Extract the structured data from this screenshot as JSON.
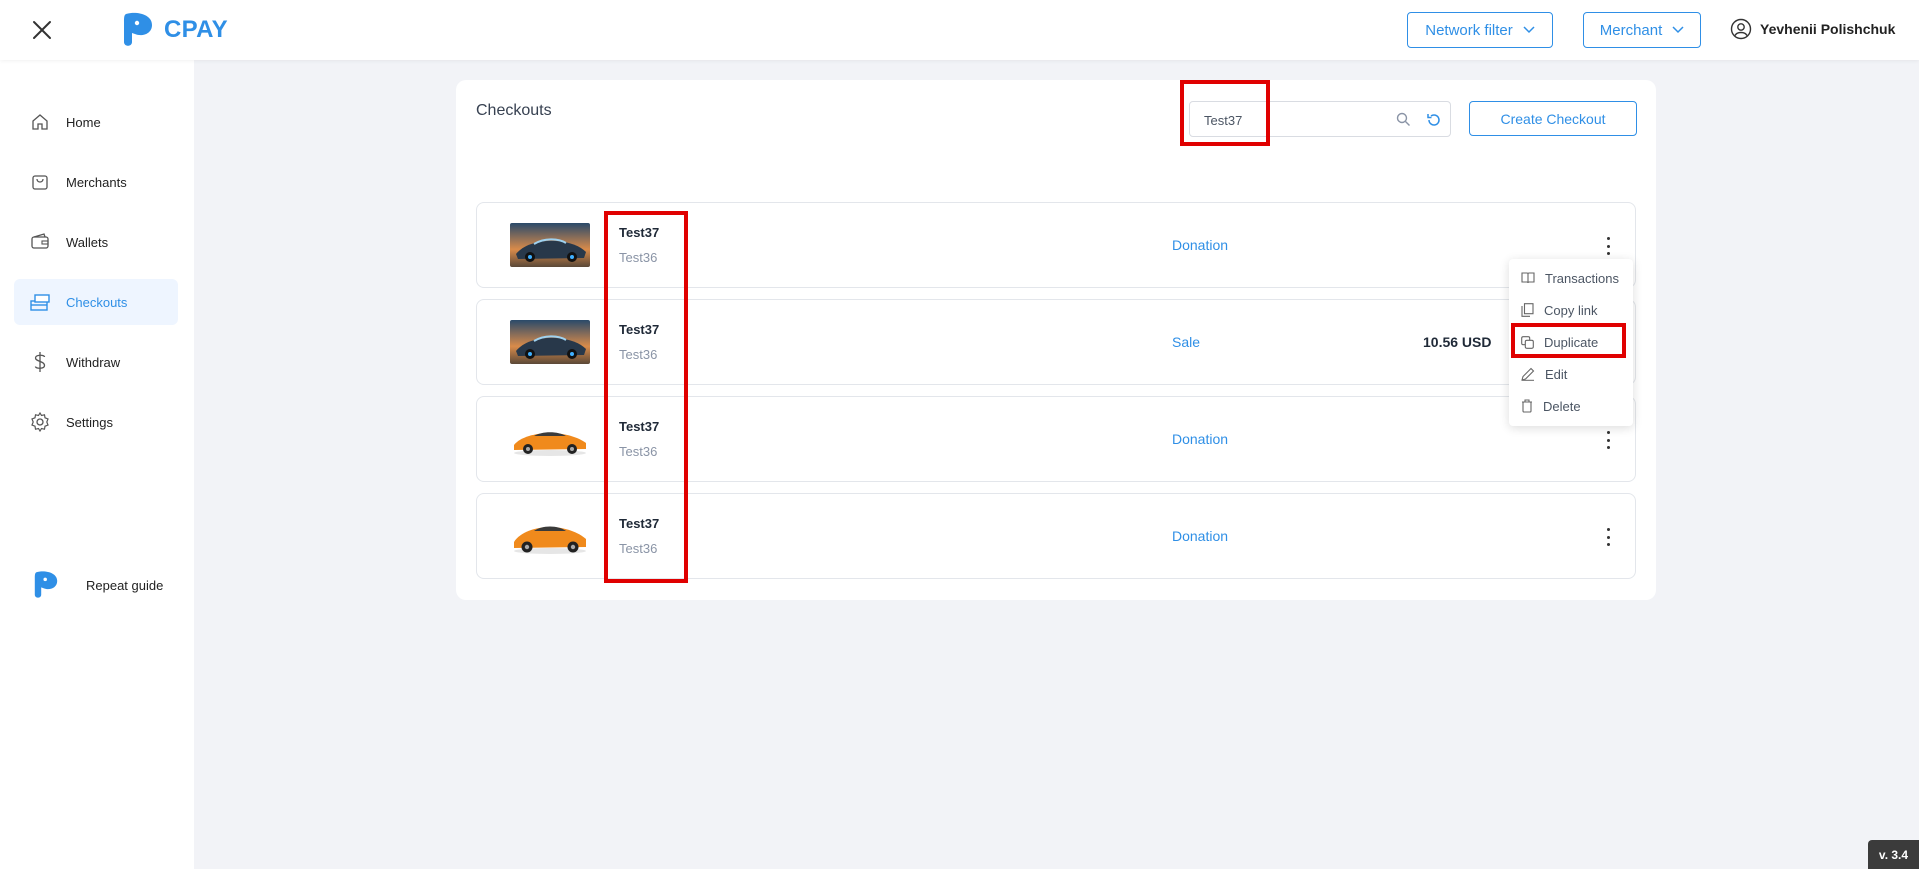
{
  "app": {
    "brand": "CPAY"
  },
  "header": {
    "network_filter_label": "Network filter",
    "merchant_label": "Merchant",
    "user_name": "Yevhenii Polishchuk"
  },
  "sidebar": {
    "items": [
      {
        "label": "Home"
      },
      {
        "label": "Merchants"
      },
      {
        "label": "Wallets"
      },
      {
        "label": "Checkouts"
      },
      {
        "label": "Withdraw"
      },
      {
        "label": "Settings"
      }
    ],
    "guide_label": "Repeat guide"
  },
  "main": {
    "title": "Checkouts",
    "search_value": "Test37",
    "create_label": "Create Checkout",
    "rows": [
      {
        "name": "Test37",
        "sub": "Test36",
        "type": "Donation",
        "amount": ""
      },
      {
        "name": "Test37",
        "sub": "Test36",
        "type": "Sale",
        "amount": "10.56 USD"
      },
      {
        "name": "Test37",
        "sub": "Test36",
        "type": "Donation",
        "amount": ""
      },
      {
        "name": "Test37",
        "sub": "Test36",
        "type": "Donation",
        "amount": ""
      }
    ]
  },
  "menu": {
    "items": [
      {
        "label": "Transactions"
      },
      {
        "label": "Copy link"
      },
      {
        "label": "Duplicate"
      },
      {
        "label": "Edit"
      },
      {
        "label": "Delete"
      }
    ]
  },
  "version": "v. 3.4",
  "colors": {
    "accent": "#2f8fe6",
    "highlight": "#e00000",
    "background": "#f2f3f7"
  }
}
